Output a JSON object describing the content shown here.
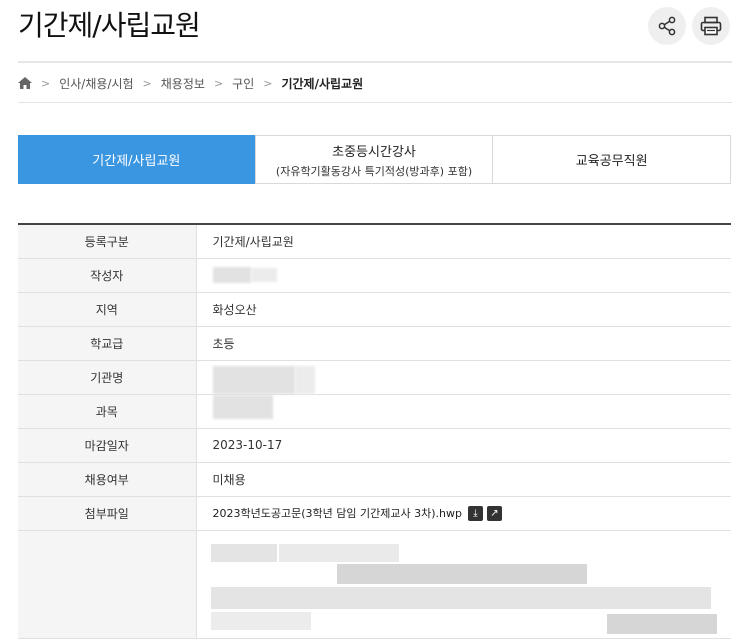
{
  "page": {
    "title": "기간제/사립교원"
  },
  "breadcrumb": {
    "items": [
      "인사/채용/시험",
      "채용정보",
      "구인"
    ],
    "current": "기간제/사립교원"
  },
  "tabs": [
    {
      "label": "기간제/사립교원",
      "sub": ""
    },
    {
      "label": "초중등시간강사",
      "sub": "(자유학기활동강사 특기적성(방과후) 포함)"
    },
    {
      "label": "교육공무직원",
      "sub": ""
    }
  ],
  "table": {
    "rows": [
      {
        "label": "등록구분",
        "value": "기간제/사립교원"
      },
      {
        "label": "작성자",
        "value": ""
      },
      {
        "label": "지역",
        "value": "화성오산"
      },
      {
        "label": "학교급",
        "value": "초등"
      },
      {
        "label": "기관명",
        "value": ""
      },
      {
        "label": "과목",
        "value": ""
      },
      {
        "label": "마감일자",
        "value": "2023-10-17"
      },
      {
        "label": "채용여부",
        "value": "미채용"
      },
      {
        "label": "첨부파일",
        "value": "2023학년도공고문(3학년 담임 기간제교사 3차).hwp"
      }
    ]
  },
  "icons": {
    "home": "home-icon",
    "share": "share-icon",
    "print": "print-icon",
    "download": "download-icon",
    "preview": "preview-icon"
  },
  "colors": {
    "active_tab": "#3a96e0"
  }
}
